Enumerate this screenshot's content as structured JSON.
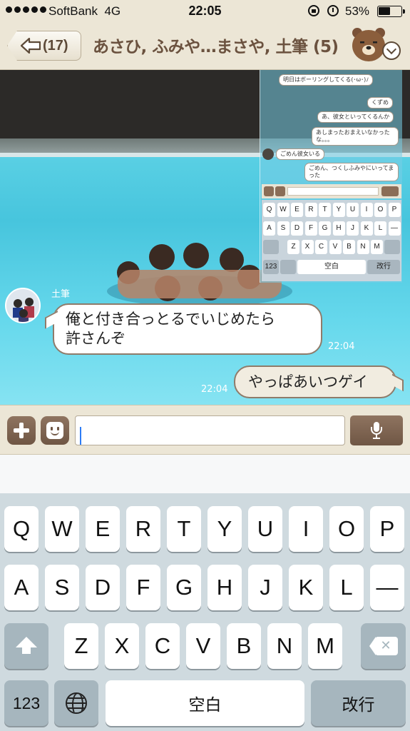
{
  "status_bar": {
    "carrier": "SoftBank",
    "network": "4G",
    "time": "22:05",
    "battery_percent": "53%",
    "battery_level": 0.53,
    "icons": [
      "signal-dots-icon",
      "rotation-lock-icon",
      "alarm-icon",
      "battery-icon"
    ]
  },
  "header": {
    "unread_count": "(17)",
    "title": "あさひ, ふみや…まさや, 土筆 (5)",
    "icons": [
      "back-arrow-icon",
      "bear-sticker-icon",
      "dropdown-chevron-icon"
    ]
  },
  "embedded_screenshot": {
    "messages": [
      "明日はボーリングしてくる(･ω･)ﾉ",
      "くずめ",
      "あ、彼女といってくるんか",
      "あしまったおまえいなかったな。。。",
      "ごめん彼女いる",
      "ごめん、つくしふみやにいってまった"
    ],
    "keyboard_rows": [
      [
        "Q",
        "W",
        "E",
        "R",
        "T",
        "Y",
        "U",
        "I",
        "O",
        "P"
      ],
      [
        "A",
        "S",
        "D",
        "F",
        "G",
        "H",
        "J",
        "K",
        "L",
        "—"
      ],
      [
        "Z",
        "X",
        "C",
        "V",
        "B",
        "N",
        "M"
      ]
    ],
    "numbers_key": "123",
    "space_key": "空白",
    "return_key": "改行"
  },
  "messages": {
    "incoming": {
      "sender": "土筆",
      "line1": "俺と付き合っとるでいじめたら",
      "line2": "許さんぞ",
      "time": "22:04"
    },
    "outgoing": {
      "text": "やっぱあいつゲイ",
      "time": "22:04"
    }
  },
  "input_bar": {
    "message_value": "",
    "icons": [
      "plus-icon",
      "emoji-icon",
      "microphone-icon"
    ]
  },
  "keyboard": {
    "row1": [
      "Q",
      "W",
      "E",
      "R",
      "T",
      "Y",
      "U",
      "I",
      "O",
      "P"
    ],
    "row2": [
      "A",
      "S",
      "D",
      "F",
      "G",
      "H",
      "J",
      "K",
      "L",
      "—"
    ],
    "row3": [
      "Z",
      "X",
      "C",
      "V",
      "B",
      "N",
      "M"
    ],
    "numbers_key": "123",
    "space_key": "空白",
    "return_key": "改行",
    "icons": [
      "shift-icon",
      "delete-icon",
      "globe-icon"
    ]
  },
  "colors": {
    "header_bg": "#ece6d6",
    "title_brown": "#6b523f",
    "button_brown": "#7d6350",
    "pool_blue": "#4fc8e0",
    "keyboard_bg": "#cfdadf",
    "caret_blue": "#2d7cf6"
  }
}
